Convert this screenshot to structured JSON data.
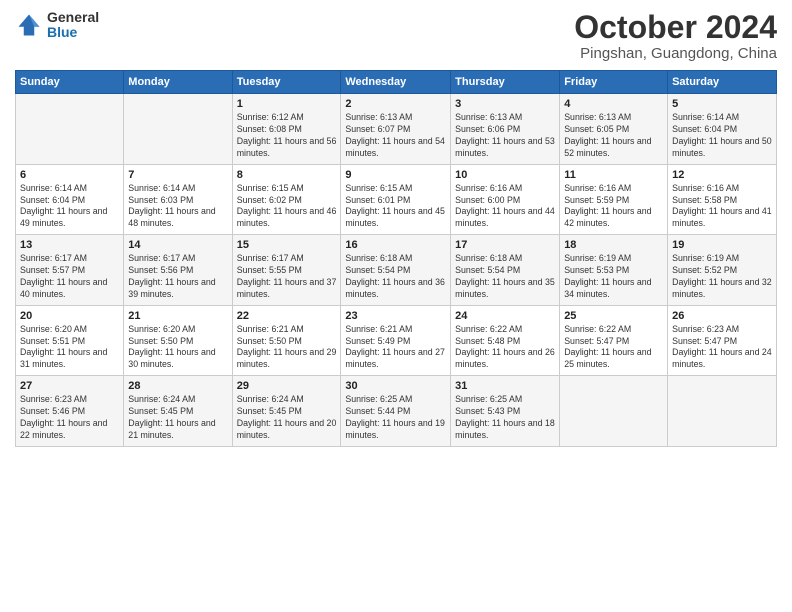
{
  "header": {
    "logo_general": "General",
    "logo_blue": "Blue",
    "month_title": "October 2024",
    "location": "Pingshan, Guangdong, China"
  },
  "days_of_week": [
    "Sunday",
    "Monday",
    "Tuesday",
    "Wednesday",
    "Thursday",
    "Friday",
    "Saturday"
  ],
  "weeks": [
    [
      {
        "day": "",
        "sunrise": "",
        "sunset": "",
        "daylight": ""
      },
      {
        "day": "",
        "sunrise": "",
        "sunset": "",
        "daylight": ""
      },
      {
        "day": "1",
        "sunrise": "Sunrise: 6:12 AM",
        "sunset": "Sunset: 6:08 PM",
        "daylight": "Daylight: 11 hours and 56 minutes."
      },
      {
        "day": "2",
        "sunrise": "Sunrise: 6:13 AM",
        "sunset": "Sunset: 6:07 PM",
        "daylight": "Daylight: 11 hours and 54 minutes."
      },
      {
        "day": "3",
        "sunrise": "Sunrise: 6:13 AM",
        "sunset": "Sunset: 6:06 PM",
        "daylight": "Daylight: 11 hours and 53 minutes."
      },
      {
        "day": "4",
        "sunrise": "Sunrise: 6:13 AM",
        "sunset": "Sunset: 6:05 PM",
        "daylight": "Daylight: 11 hours and 52 minutes."
      },
      {
        "day": "5",
        "sunrise": "Sunrise: 6:14 AM",
        "sunset": "Sunset: 6:04 PM",
        "daylight": "Daylight: 11 hours and 50 minutes."
      }
    ],
    [
      {
        "day": "6",
        "sunrise": "Sunrise: 6:14 AM",
        "sunset": "Sunset: 6:04 PM",
        "daylight": "Daylight: 11 hours and 49 minutes."
      },
      {
        "day": "7",
        "sunrise": "Sunrise: 6:14 AM",
        "sunset": "Sunset: 6:03 PM",
        "daylight": "Daylight: 11 hours and 48 minutes."
      },
      {
        "day": "8",
        "sunrise": "Sunrise: 6:15 AM",
        "sunset": "Sunset: 6:02 PM",
        "daylight": "Daylight: 11 hours and 46 minutes."
      },
      {
        "day": "9",
        "sunrise": "Sunrise: 6:15 AM",
        "sunset": "Sunset: 6:01 PM",
        "daylight": "Daylight: 11 hours and 45 minutes."
      },
      {
        "day": "10",
        "sunrise": "Sunrise: 6:16 AM",
        "sunset": "Sunset: 6:00 PM",
        "daylight": "Daylight: 11 hours and 44 minutes."
      },
      {
        "day": "11",
        "sunrise": "Sunrise: 6:16 AM",
        "sunset": "Sunset: 5:59 PM",
        "daylight": "Daylight: 11 hours and 42 minutes."
      },
      {
        "day": "12",
        "sunrise": "Sunrise: 6:16 AM",
        "sunset": "Sunset: 5:58 PM",
        "daylight": "Daylight: 11 hours and 41 minutes."
      }
    ],
    [
      {
        "day": "13",
        "sunrise": "Sunrise: 6:17 AM",
        "sunset": "Sunset: 5:57 PM",
        "daylight": "Daylight: 11 hours and 40 minutes."
      },
      {
        "day": "14",
        "sunrise": "Sunrise: 6:17 AM",
        "sunset": "Sunset: 5:56 PM",
        "daylight": "Daylight: 11 hours and 39 minutes."
      },
      {
        "day": "15",
        "sunrise": "Sunrise: 6:17 AM",
        "sunset": "Sunset: 5:55 PM",
        "daylight": "Daylight: 11 hours and 37 minutes."
      },
      {
        "day": "16",
        "sunrise": "Sunrise: 6:18 AM",
        "sunset": "Sunset: 5:54 PM",
        "daylight": "Daylight: 11 hours and 36 minutes."
      },
      {
        "day": "17",
        "sunrise": "Sunrise: 6:18 AM",
        "sunset": "Sunset: 5:54 PM",
        "daylight": "Daylight: 11 hours and 35 minutes."
      },
      {
        "day": "18",
        "sunrise": "Sunrise: 6:19 AM",
        "sunset": "Sunset: 5:53 PM",
        "daylight": "Daylight: 11 hours and 34 minutes."
      },
      {
        "day": "19",
        "sunrise": "Sunrise: 6:19 AM",
        "sunset": "Sunset: 5:52 PM",
        "daylight": "Daylight: 11 hours and 32 minutes."
      }
    ],
    [
      {
        "day": "20",
        "sunrise": "Sunrise: 6:20 AM",
        "sunset": "Sunset: 5:51 PM",
        "daylight": "Daylight: 11 hours and 31 minutes."
      },
      {
        "day": "21",
        "sunrise": "Sunrise: 6:20 AM",
        "sunset": "Sunset: 5:50 PM",
        "daylight": "Daylight: 11 hours and 30 minutes."
      },
      {
        "day": "22",
        "sunrise": "Sunrise: 6:21 AM",
        "sunset": "Sunset: 5:50 PM",
        "daylight": "Daylight: 11 hours and 29 minutes."
      },
      {
        "day": "23",
        "sunrise": "Sunrise: 6:21 AM",
        "sunset": "Sunset: 5:49 PM",
        "daylight": "Daylight: 11 hours and 27 minutes."
      },
      {
        "day": "24",
        "sunrise": "Sunrise: 6:22 AM",
        "sunset": "Sunset: 5:48 PM",
        "daylight": "Daylight: 11 hours and 26 minutes."
      },
      {
        "day": "25",
        "sunrise": "Sunrise: 6:22 AM",
        "sunset": "Sunset: 5:47 PM",
        "daylight": "Daylight: 11 hours and 25 minutes."
      },
      {
        "day": "26",
        "sunrise": "Sunrise: 6:23 AM",
        "sunset": "Sunset: 5:47 PM",
        "daylight": "Daylight: 11 hours and 24 minutes."
      }
    ],
    [
      {
        "day": "27",
        "sunrise": "Sunrise: 6:23 AM",
        "sunset": "Sunset: 5:46 PM",
        "daylight": "Daylight: 11 hours and 22 minutes."
      },
      {
        "day": "28",
        "sunrise": "Sunrise: 6:24 AM",
        "sunset": "Sunset: 5:45 PM",
        "daylight": "Daylight: 11 hours and 21 minutes."
      },
      {
        "day": "29",
        "sunrise": "Sunrise: 6:24 AM",
        "sunset": "Sunset: 5:45 PM",
        "daylight": "Daylight: 11 hours and 20 minutes."
      },
      {
        "day": "30",
        "sunrise": "Sunrise: 6:25 AM",
        "sunset": "Sunset: 5:44 PM",
        "daylight": "Daylight: 11 hours and 19 minutes."
      },
      {
        "day": "31",
        "sunrise": "Sunrise: 6:25 AM",
        "sunset": "Sunset: 5:43 PM",
        "daylight": "Daylight: 11 hours and 18 minutes."
      },
      {
        "day": "",
        "sunrise": "",
        "sunset": "",
        "daylight": ""
      },
      {
        "day": "",
        "sunrise": "",
        "sunset": "",
        "daylight": ""
      }
    ]
  ]
}
